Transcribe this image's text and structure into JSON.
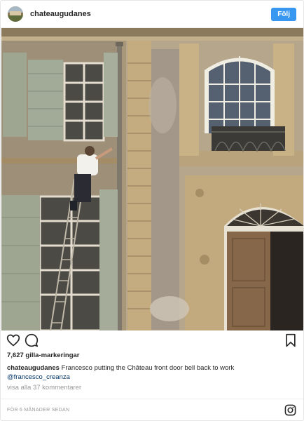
{
  "header": {
    "username": "chateaugudanes",
    "follow_label": "Följ"
  },
  "post": {
    "likes": "7,627 gilla-markeringar",
    "caption_username": "chateaugudanes",
    "caption_text": "Francesco putting the Château front door bell back to work",
    "caption_mention": "@francesco_creanza",
    "comments_link": "visa alla 37 kommentarer",
    "timestamp": "FÖR 6 MÅNADER SEDAN"
  },
  "icons": {
    "like": "heart-icon",
    "comment": "comment-icon",
    "save": "bookmark-icon",
    "brand": "instagram-icon"
  },
  "colors": {
    "follow_button": "#3897f0",
    "text": "#262626",
    "muted": "#999999"
  }
}
